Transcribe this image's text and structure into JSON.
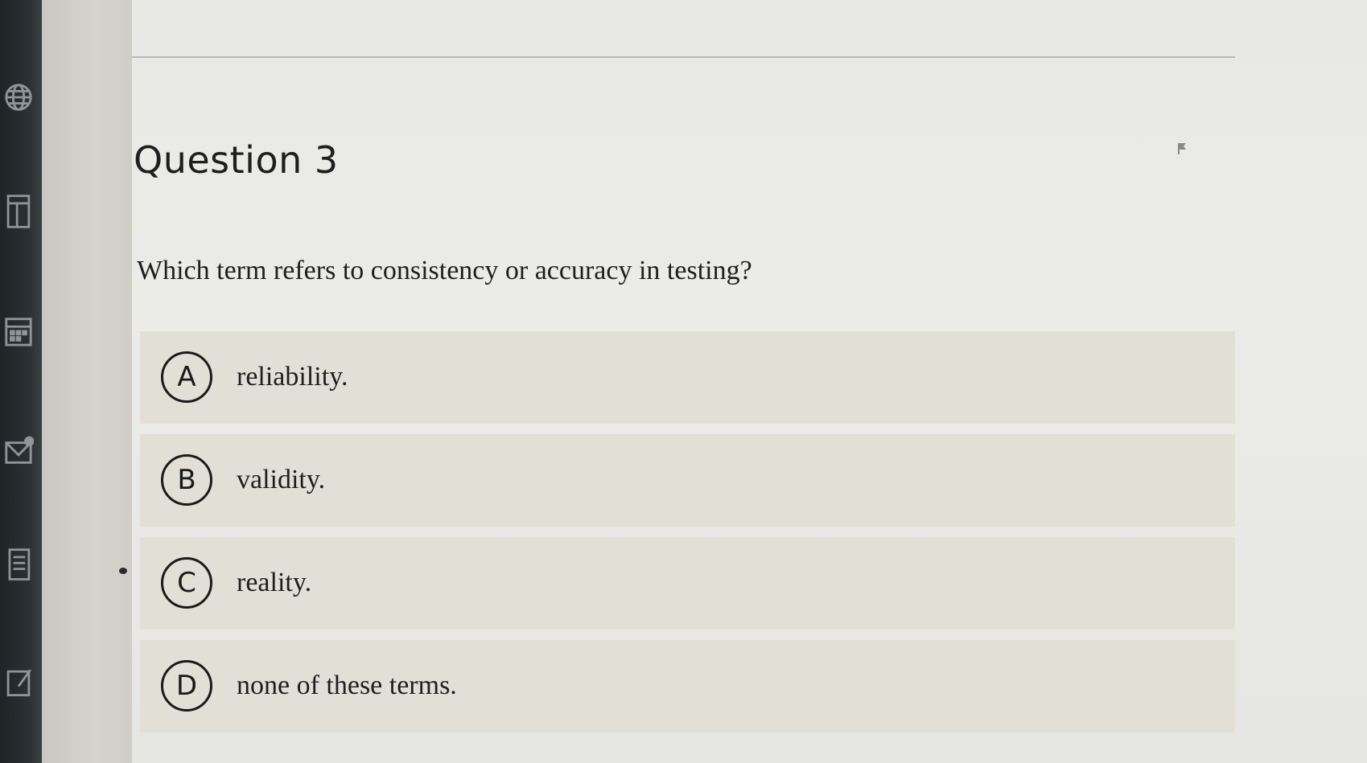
{
  "rail": {
    "icons": [
      "globe-icon",
      "panel-icon",
      "calendar-icon",
      "inbox-icon",
      "document-icon",
      "edit-icon"
    ]
  },
  "question": {
    "title": "Question 3",
    "text": "Which term refers to consistency or accuracy in testing?",
    "options": [
      {
        "letter": "A",
        "label": "reliability."
      },
      {
        "letter": "B",
        "label": "validity."
      },
      {
        "letter": "C",
        "label": "reality."
      },
      {
        "letter": "D",
        "label": "none of these terms."
      }
    ]
  }
}
